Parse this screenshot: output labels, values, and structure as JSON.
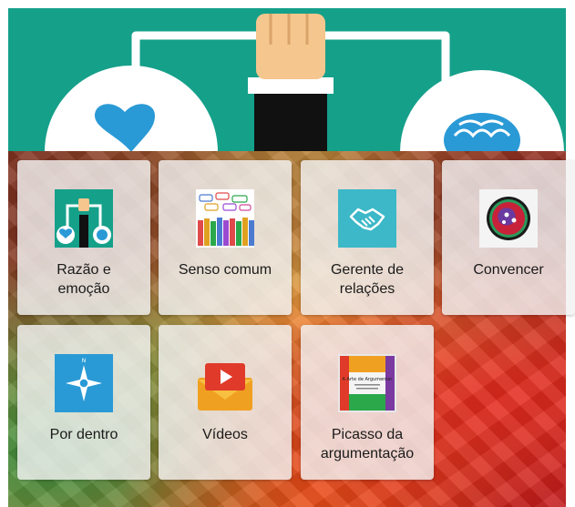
{
  "banner": {
    "background": "#15a08a",
    "illustration": "balance-scale-heart-brain-illustration"
  },
  "tiles": [
    {
      "label_line1": "Razão e",
      "label_line2": "emoção",
      "icon": "scale-heart-brain-icon"
    },
    {
      "label_line1": "Senso comum",
      "label_line2": "",
      "icon": "crowd-speech-bubbles-icon"
    },
    {
      "label_line1": "Gerente de",
      "label_line2": "relações",
      "icon": "handshake-icon"
    },
    {
      "label_line1": "Convencer",
      "label_line2": "",
      "icon": "persuasion-mouth-icon"
    },
    {
      "label_line1": "Por dentro",
      "label_line2": "",
      "icon": "compass-icon"
    },
    {
      "label_line1": "Vídeos",
      "label_line2": "",
      "icon": "video-play-icon"
    },
    {
      "label_line1": "Picasso da",
      "label_line2": "argumentação",
      "icon": "book-cover-icon",
      "cover_title": "A Arte de Argumentar"
    }
  ]
}
